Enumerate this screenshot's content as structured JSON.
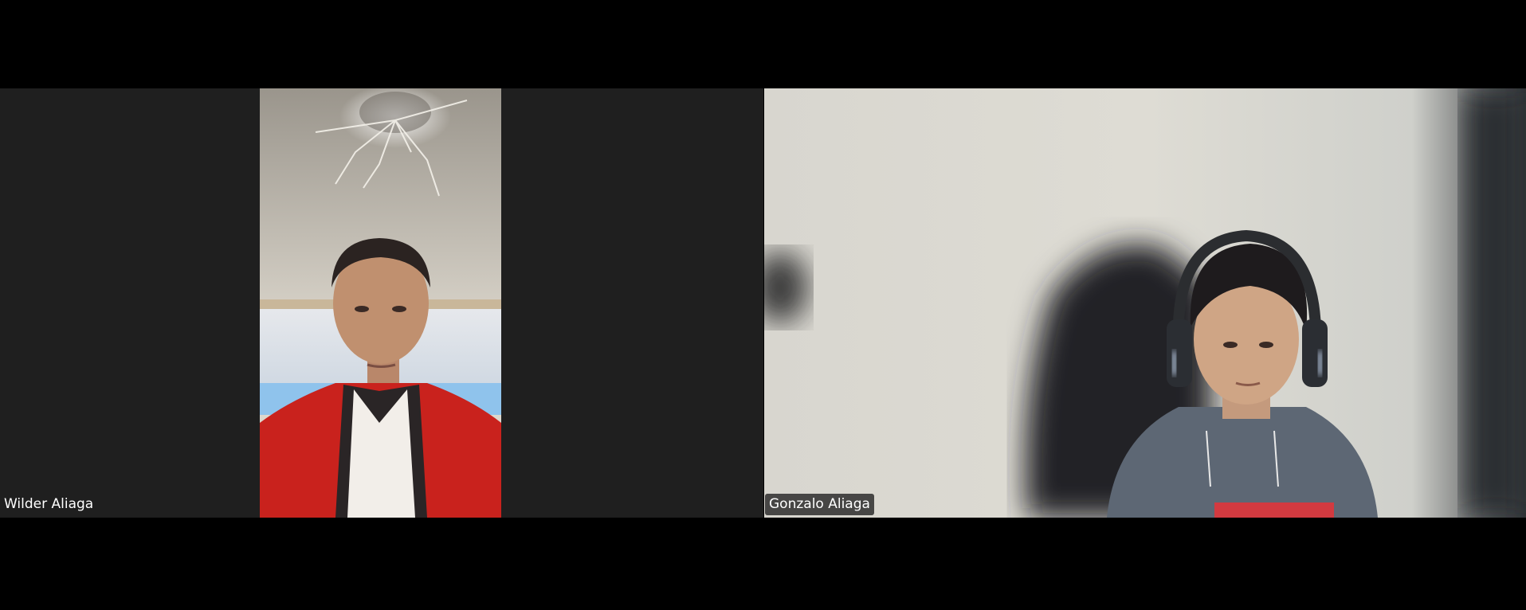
{
  "participants": [
    {
      "name": "Wilder Aliaga",
      "video_icon": "participant-video-portrait"
    },
    {
      "name": "Gonzalo Aliaga",
      "video_icon": "participant-video-landscape"
    }
  ],
  "colors": {
    "background": "#000000",
    "tile_background": "#1f1f1f",
    "name_tag_text": "#ffffff",
    "name_tag_background": "#1e1e1e"
  }
}
